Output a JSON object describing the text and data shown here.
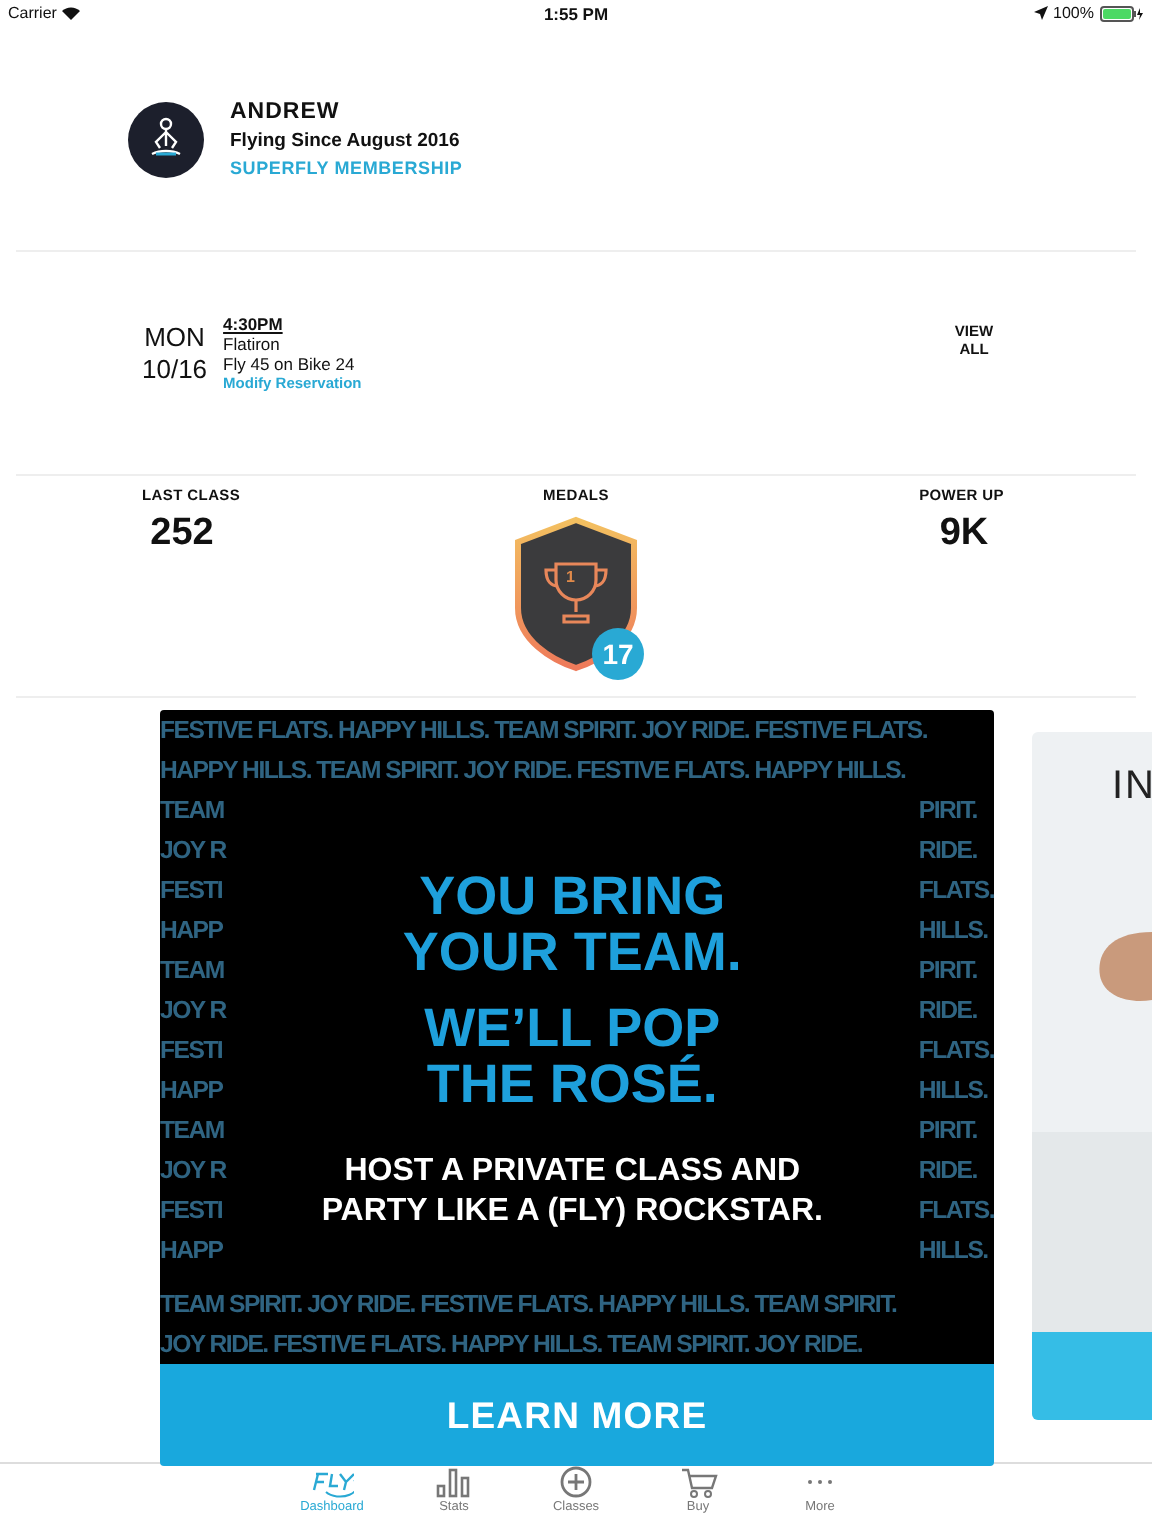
{
  "status_bar": {
    "carrier": "Carrier",
    "time": "1:55 PM",
    "battery": "100%"
  },
  "profile": {
    "name": "ANDREW",
    "since": "Flying Since August 2016",
    "membership": "SUPERFLY MEMBERSHIP"
  },
  "reservation": {
    "day": "MON",
    "date": "10/16",
    "time": "4:30PM",
    "studio": "Flatiron",
    "class": "Fly 45 on Bike 24",
    "action": "Modify Reservation",
    "view_all": "VIEW ALL"
  },
  "stats": [
    {
      "kind": "number",
      "label": "LAST CLASS",
      "value": "252"
    },
    {
      "kind": "medal",
      "label": "MEDALS",
      "rank": "1",
      "count": "17"
    },
    {
      "kind": "number",
      "label": "POWER UP",
      "value": "9K"
    }
  ],
  "promos": [
    {
      "kind": "banner",
      "pattern_top": [
        "FESTIVE FLATS. HAPPY HILLS. TEAM SPIRIT. JOY RIDE. FESTIVE FLATS.",
        "HAPPY HILLS. TEAM SPIRIT. JOY RIDE.  FESTIVE FLATS. HAPPY HILLS."
      ],
      "pattern_left": [
        "TEAM",
        "JOY R",
        "FESTI",
        "HAPP",
        "TEAM",
        "JOY R",
        "FESTI",
        "HAPP",
        "TEAM",
        "JOY R",
        "FESTI",
        "HAPP"
      ],
      "pattern_right": [
        "PIRIT.",
        "RIDE.",
        "FLATS.",
        "HILLS.",
        "PIRIT.",
        "RIDE.",
        "FLATS.",
        "HILLS.",
        "PIRIT.",
        "RIDE.",
        "FLATS.",
        "HILLS."
      ],
      "pattern_bottom": [
        "TEAM SPIRIT. JOY RIDE.  FESTIVE FLATS. HAPPY HILLS. TEAM SPIRIT.",
        "JOY RIDE.  FESTIVE FLATS.  HAPPY HILLS.  TEAM SPIRIT.  JOY RIDE."
      ],
      "headline": [
        "YOU BRING YOUR TEAM.",
        "WE’LL POP THE ROSÉ."
      ],
      "subline": "HOST A PRIVATE CLASS AND PARTY LIKE A (FLY) ROCKSTAR.",
      "button": "LEARN MORE"
    },
    {
      "kind": "picture",
      "text": "IN"
    }
  ],
  "tabs": [
    {
      "label": "Dashboard",
      "selected": true
    },
    {
      "label": "Stats",
      "selected": false
    },
    {
      "label": "Classes",
      "selected": false
    },
    {
      "label": "Buy",
      "selected": false
    },
    {
      "label": "More",
      "selected": false
    }
  ]
}
